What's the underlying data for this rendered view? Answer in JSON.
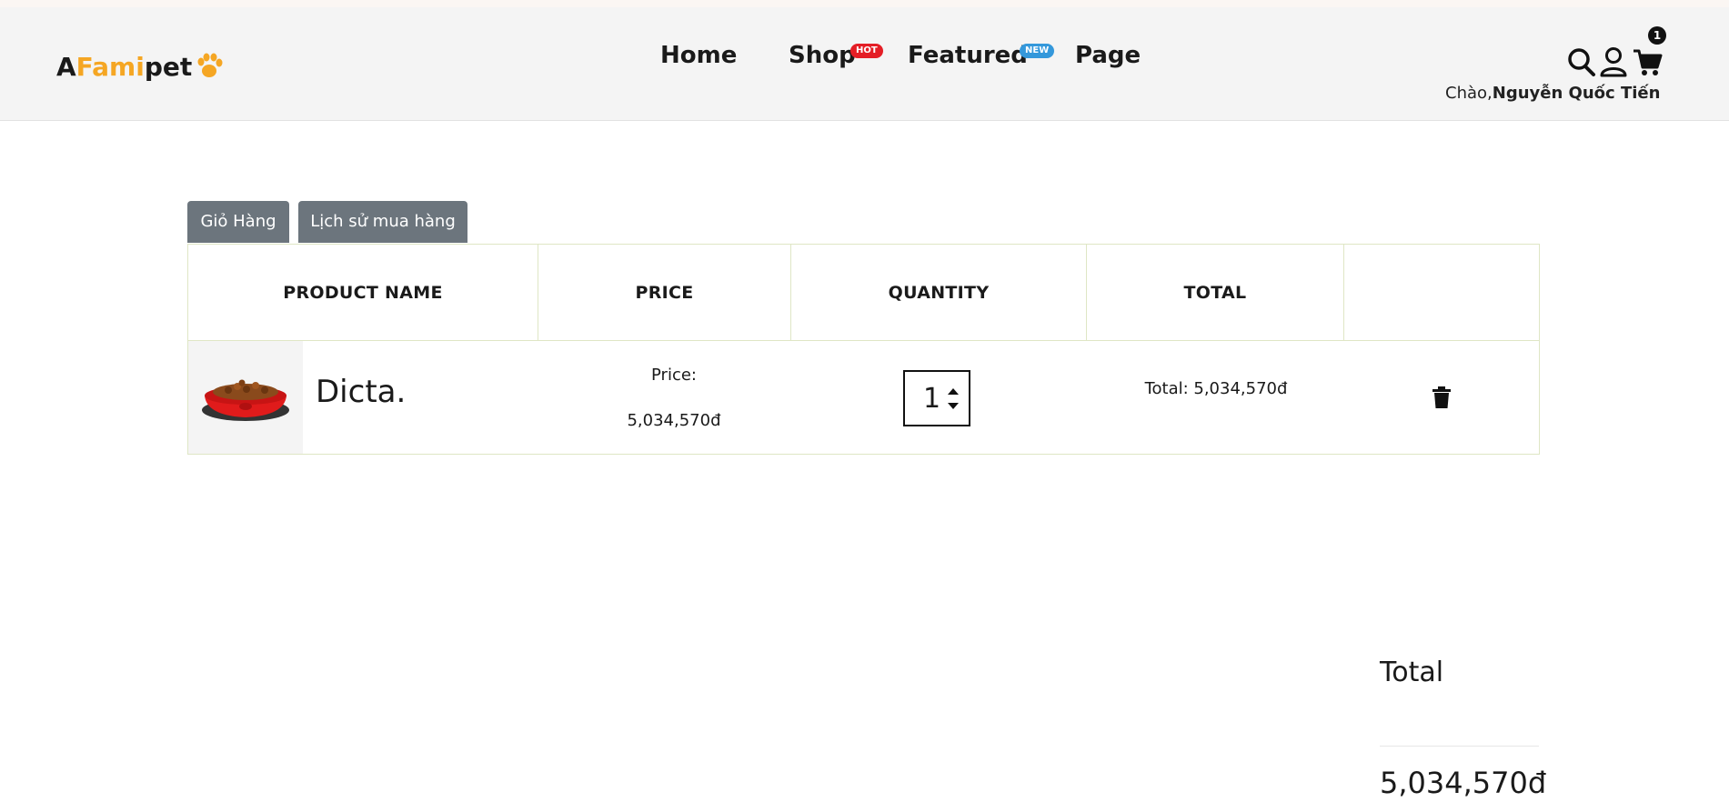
{
  "header": {
    "logo": {
      "a": "A",
      "fami": "Fami",
      "pet": "pet"
    },
    "nav": [
      {
        "label": "Home"
      },
      {
        "label": "Shop",
        "badge": "HOT"
      },
      {
        "label": "Featured",
        "badge": "NEW"
      },
      {
        "label": "Page"
      }
    ],
    "icons": [
      "search-icon",
      "user-icon",
      "cart-icon"
    ],
    "cart_count": "1",
    "greeting_prefix": "Chào,",
    "user_name": "Nguyễn Quốc Tiến",
    "colors": {
      "brand": "#f5a623",
      "hot_badge": "#e41e26",
      "new_badge": "#3498db"
    }
  },
  "tabs": [
    {
      "label": "Giỏ Hàng"
    },
    {
      "label": "Lịch sử mua hàng"
    }
  ],
  "cart": {
    "columns": [
      "PRODUCT NAME",
      "PRICE",
      "QUANTITY",
      "TOTAL",
      ""
    ],
    "rows": [
      {
        "name": "Dicta.",
        "price_label": "Price:",
        "price": "5,034,570đ",
        "quantity": "1",
        "total": "Total: 5,034,570đ"
      }
    ]
  },
  "summary": {
    "title": "Total",
    "value": "5,034,570đ"
  }
}
